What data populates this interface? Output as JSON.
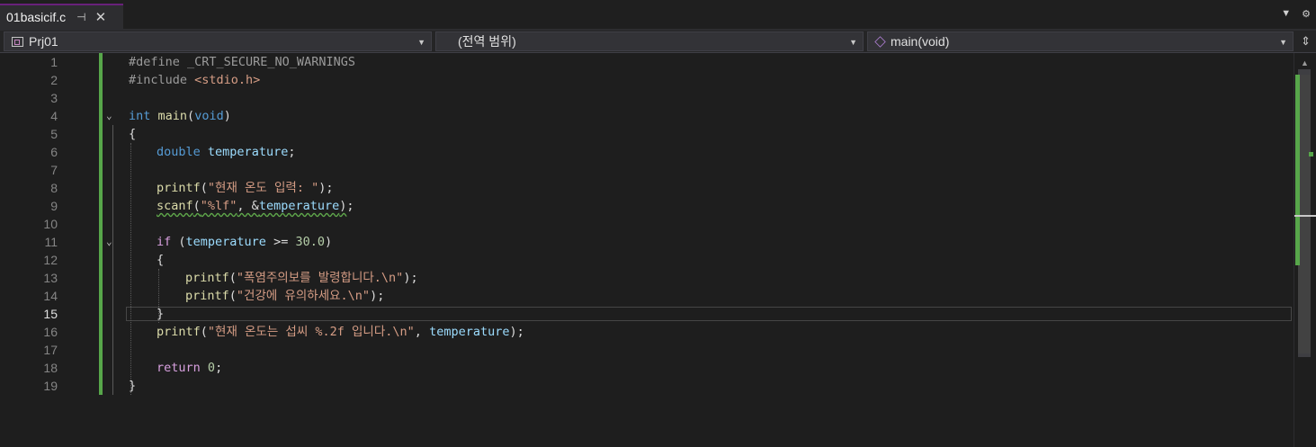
{
  "tab": {
    "title": "01basicif.c",
    "pin_icon": "pin-icon",
    "close_icon": "close-icon"
  },
  "tabstrip_right": {
    "dropdown_icon": "chevron-down-icon",
    "settings_icon": "gear-icon"
  },
  "navbar": {
    "project": "Prj01",
    "scope": "(전역 범위)",
    "member": "main(void)"
  },
  "editor": {
    "active_line": 15,
    "lines": [
      {
        "n": "1"
      },
      {
        "n": "2"
      },
      {
        "n": "3"
      },
      {
        "n": "4"
      },
      {
        "n": "5"
      },
      {
        "n": "6"
      },
      {
        "n": "7"
      },
      {
        "n": "8"
      },
      {
        "n": "9"
      },
      {
        "n": "10"
      },
      {
        "n": "11"
      },
      {
        "n": "12"
      },
      {
        "n": "13"
      },
      {
        "n": "14"
      },
      {
        "n": "15"
      },
      {
        "n": "16"
      },
      {
        "n": "17"
      },
      {
        "n": "18"
      },
      {
        "n": "19"
      }
    ],
    "tokens": {
      "l1_dir": "#define _CRT_SECURE_NO_WARNINGS",
      "l2_dir": "#include ",
      "l2_hdr": "<stdio.h>",
      "l4_int": "int",
      "l4_main": "main",
      "l4_open": "(",
      "l4_void": "void",
      "l4_close": ")",
      "l5": "{",
      "l6_type": "double",
      "l6_var": "temperature",
      "l6_semi": ";",
      "l8_fn": "printf",
      "l8_open": "(",
      "l8_str": "\"현재 온도 입력: \"",
      "l8_close": ");",
      "l9_fn": "scanf",
      "l9_open": "(",
      "l9_str": "\"%lf\"",
      "l9_mid": ", &",
      "l9_var": "temperature",
      "l9_close": ");",
      "l11_if": "if",
      "l11_open": " (",
      "l11_var": "temperature",
      "l11_op": " >= ",
      "l11_num": "30.0",
      "l11_close": ")",
      "l12": "{",
      "l13_fn": "printf",
      "l13_open": "(",
      "l13_str": "\"폭염주의보를 발령합니다.\\n\"",
      "l13_close": ");",
      "l14_fn": "printf",
      "l14_open": "(",
      "l14_str": "\"건강에 유의하세요.\\n\"",
      "l14_close": ");",
      "l15": "}",
      "l16_fn": "printf",
      "l16_open": "(",
      "l16_str": "\"현재 온도는 섭씨 %.2f 입니다.\\n\"",
      "l16_mid": ", ",
      "l16_var": "temperature",
      "l16_close": ");",
      "l18_ret": "return",
      "l18_num": "0",
      "l18_semi": ";",
      "l19": "}"
    }
  },
  "colors": {
    "keyword": "#569cd6",
    "control_keyword": "#d8a0df",
    "string": "#d69d85",
    "function": "#dcdcaa",
    "variable": "#9cdcfe",
    "number": "#b5cea8",
    "change_marker": "#57a64a"
  }
}
